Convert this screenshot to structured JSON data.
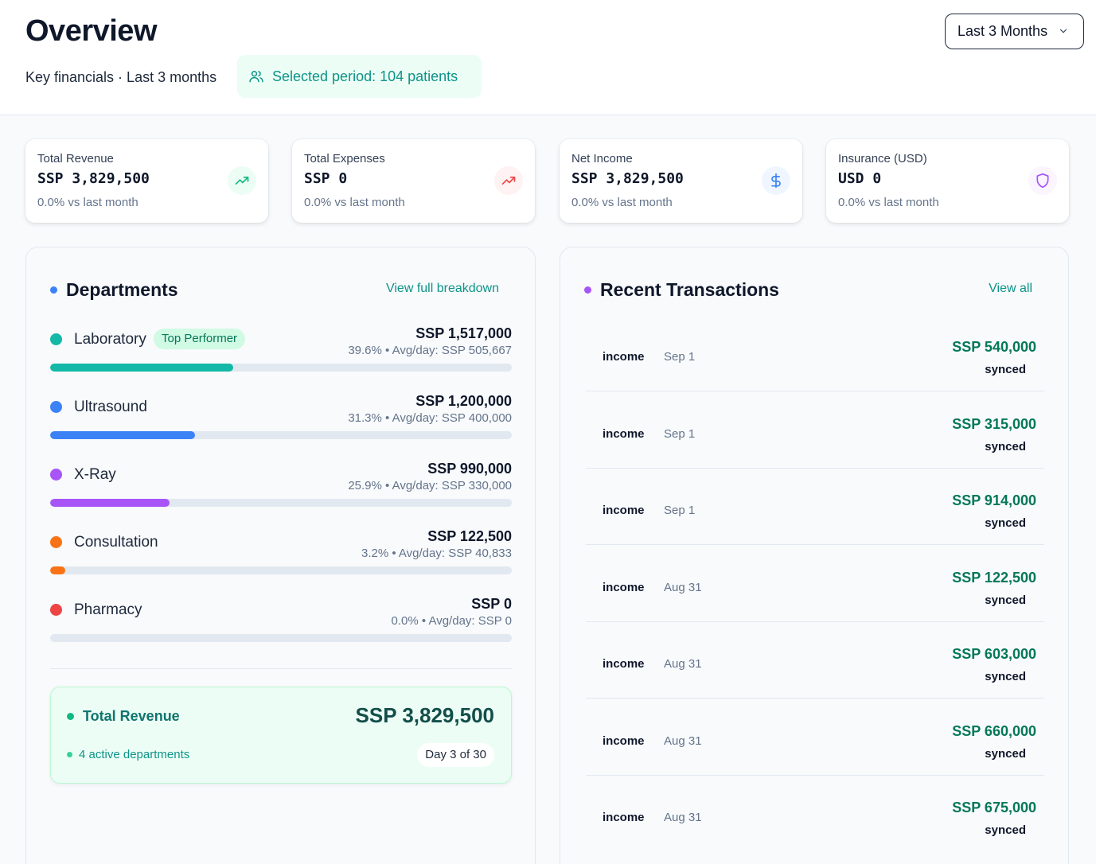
{
  "header": {
    "title": "Overview",
    "subtitle": "Key financials · Last 3 months",
    "period_chip": "Selected period: 104 patients",
    "range_select": "Last 3 Months"
  },
  "kpis": [
    {
      "label": "Total Revenue",
      "value": "SSP 3,829,500",
      "delta": "0.0% vs last month",
      "icon": "trending-up-icon",
      "color": "#10b981",
      "bg": "#ecfdf5"
    },
    {
      "label": "Total Expenses",
      "value": "SSP 0",
      "delta": "0.0% vs last month",
      "icon": "trending-up-icon",
      "color": "#ef4444",
      "bg": "#fef2f2"
    },
    {
      "label": "Net Income",
      "value": "SSP 3,829,500",
      "delta": "0.0% vs last month",
      "icon": "dollar-icon",
      "color": "#3b82f6",
      "bg": "#eff6ff"
    },
    {
      "label": "Insurance (USD)",
      "value": "USD 0",
      "delta": "0.0% vs last month",
      "icon": "shield-icon",
      "color": "#a855f7",
      "bg": "#faf5ff"
    }
  ],
  "departments": {
    "title": "Departments",
    "link": "View full breakdown",
    "accent": "#3b82f6",
    "items": [
      {
        "name": "Laboratory",
        "badge": "Top Performer",
        "amount": "SSP 1,517,000",
        "meta": "39.6% • Avg/day: SSP 505,667",
        "share": 0.396,
        "color": "#14b8a6"
      },
      {
        "name": "Ultrasound",
        "amount": "SSP 1,200,000",
        "meta": "31.3% • Avg/day: SSP 400,000",
        "share": 0.313,
        "color": "#3b82f6"
      },
      {
        "name": "X-Ray",
        "amount": "SSP 990,000",
        "meta": "25.9% • Avg/day: SSP 330,000",
        "share": 0.259,
        "color": "#a855f7"
      },
      {
        "name": "Consultation",
        "amount": "SSP 122,500",
        "meta": "3.2% • Avg/day: SSP 40,833",
        "share": 0.032,
        "color": "#f97316"
      },
      {
        "name": "Pharmacy",
        "amount": "SSP 0",
        "meta": "0.0% • Avg/day: SSP 0",
        "share": 0.0,
        "color": "#ef4444"
      }
    ],
    "total": {
      "label": "Total Revenue",
      "value": "SSP 3,829,500",
      "active": "4 active departments",
      "day": "Day 3 of 30"
    }
  },
  "transactions": {
    "title": "Recent Transactions",
    "link": "View all",
    "accent": "#a855f7",
    "items": [
      {
        "type": "income",
        "date": "Sep 1",
        "amount": "SSP 540,000",
        "status": "synced"
      },
      {
        "type": "income",
        "date": "Sep 1",
        "amount": "SSP 315,000",
        "status": "synced"
      },
      {
        "type": "income",
        "date": "Sep 1",
        "amount": "SSP 914,000",
        "status": "synced"
      },
      {
        "type": "income",
        "date": "Aug 31",
        "amount": "SSP 122,500",
        "status": "synced"
      },
      {
        "type": "income",
        "date": "Aug 31",
        "amount": "SSP 603,000",
        "status": "synced"
      },
      {
        "type": "income",
        "date": "Aug 31",
        "amount": "SSP 660,000",
        "status": "synced"
      },
      {
        "type": "income",
        "date": "Aug 31",
        "amount": "SSP 675,000",
        "status": "synced"
      }
    ]
  }
}
